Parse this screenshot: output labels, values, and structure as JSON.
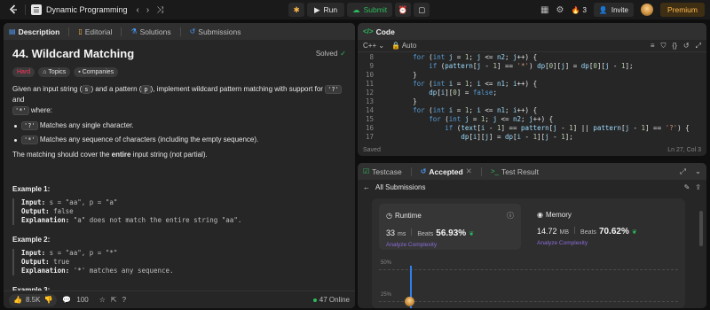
{
  "topbar": {
    "problem_list_label": "Dynamic Programming",
    "run_label": "Run",
    "submit_label": "Submit",
    "streak": "3",
    "invite_label": "Invite",
    "premium_label": "Premium"
  },
  "left": {
    "tabs": [
      "Description",
      "Editorial",
      "Solutions",
      "Submissions"
    ],
    "title": "44. Wildcard Matching",
    "solved_label": "Solved",
    "badges": {
      "difficulty": "Hard",
      "topics": "Topics",
      "companies": "Companies"
    },
    "intro_1": "Given an input string (",
    "intro_s": "s",
    "intro_2": ") and a pattern (",
    "intro_p": "p",
    "intro_3": "), implement wildcard pattern matching with support for",
    "q_code": "'?'",
    "intro_and": "and",
    "star_code": "'*'",
    "intro_where": "where:",
    "bullet1_code": "'?'",
    "bullet1_text": "Matches any single character.",
    "bullet2_code": "'*'",
    "bullet2_text": "Matches any sequence of characters (including the empty sequence).",
    "cover_1": "The matching should cover the",
    "cover_bold": "entire",
    "cover_2": "input string (not partial).",
    "examples": [
      {
        "title": "Example 1:",
        "input_label": "Input:",
        "input": "s = \"aa\", p = \"a\"",
        "output_label": "Output:",
        "output": "false",
        "exp_label": "Explanation:",
        "exp": "\"a\" does not match the entire string \"aa\"."
      },
      {
        "title": "Example 2:",
        "input_label": "Input:",
        "input": "s = \"aa\", p = \"*\"",
        "output_label": "Output:",
        "output": "true",
        "exp_label": "Explanation:",
        "exp": "'*' matches any sequence."
      },
      {
        "title": "Example 3:"
      }
    ],
    "footer": {
      "likes": "8.5K",
      "comments": "100",
      "online": "47 Online"
    }
  },
  "code": {
    "tab_label": "Code",
    "language": "C++",
    "auto_label": "Auto",
    "status_saved": "Saved",
    "cursor_pos": "Ln 27, Col 3",
    "lines": [
      {
        "n": "8"
      },
      {
        "n": "9"
      },
      {
        "n": "10"
      },
      {
        "n": "11"
      },
      {
        "n": "12"
      },
      {
        "n": "13"
      },
      {
        "n": "14"
      },
      {
        "n": "15"
      },
      {
        "n": "16"
      },
      {
        "n": "17"
      }
    ]
  },
  "result": {
    "tabs": [
      "Testcase",
      "Accepted",
      "Test Result"
    ],
    "back_label": "All Submissions",
    "runtime": {
      "title": "Runtime",
      "value": "33",
      "unit": "ms",
      "beats_label": "Beats",
      "pct": "56.93%",
      "analyze": "Analyze Complexity"
    },
    "memory": {
      "title": "Memory",
      "value": "14.72",
      "unit": "MB",
      "beats_label": "Beats",
      "pct": "70.62%",
      "analyze": "Analyze Complexity"
    },
    "chart": {
      "gl_top": "50%",
      "gl_bottom": "25%"
    }
  }
}
